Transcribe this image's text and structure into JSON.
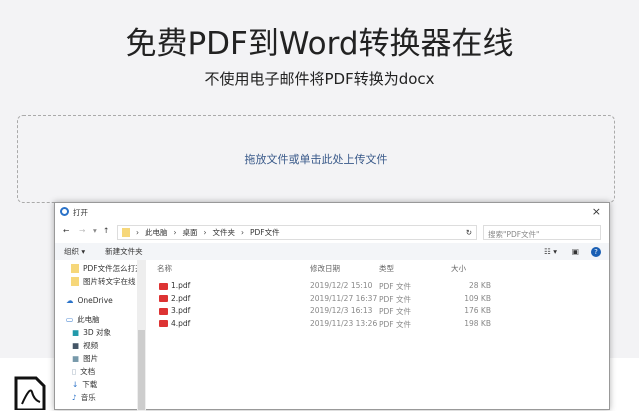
{
  "page": {
    "title": "免费PDF到Word转换器在线",
    "subtitle": "不使用电子邮件将PDF转换为docx",
    "drop_text": "拖放文件或单击此处上传文件"
  },
  "dialog": {
    "title": "打开",
    "close": "×",
    "path": [
      "此电脑",
      "桌面",
      "文件夹",
      "PDF文件"
    ],
    "search_placeholder": "搜索\"PDF文件\"",
    "organize": "组织 ▾",
    "new_folder": "新建文件夹",
    "sidebar": [
      "PDF文件怎么打开",
      "图片转文字在线",
      "OneDrive",
      "此电脑",
      "3D 对象",
      "视频",
      "图片",
      "文档",
      "下载",
      "音乐"
    ],
    "columns": [
      "名称",
      "修改日期",
      "类型",
      "大小"
    ],
    "files": [
      {
        "name": "1.pdf",
        "date": "2019/12/2 15:10",
        "type": "PDF 文件",
        "size": "28 KB"
      },
      {
        "name": "2.pdf",
        "date": "2019/11/27 16:37",
        "type": "PDF 文件",
        "size": "109 KB"
      },
      {
        "name": "3.pdf",
        "date": "2019/12/3 16:13",
        "type": "PDF 文件",
        "size": "176 KB"
      },
      {
        "name": "4.pdf",
        "date": "2019/11/23 13:26",
        "type": "PDF 文件",
        "size": "198 KB"
      }
    ]
  }
}
